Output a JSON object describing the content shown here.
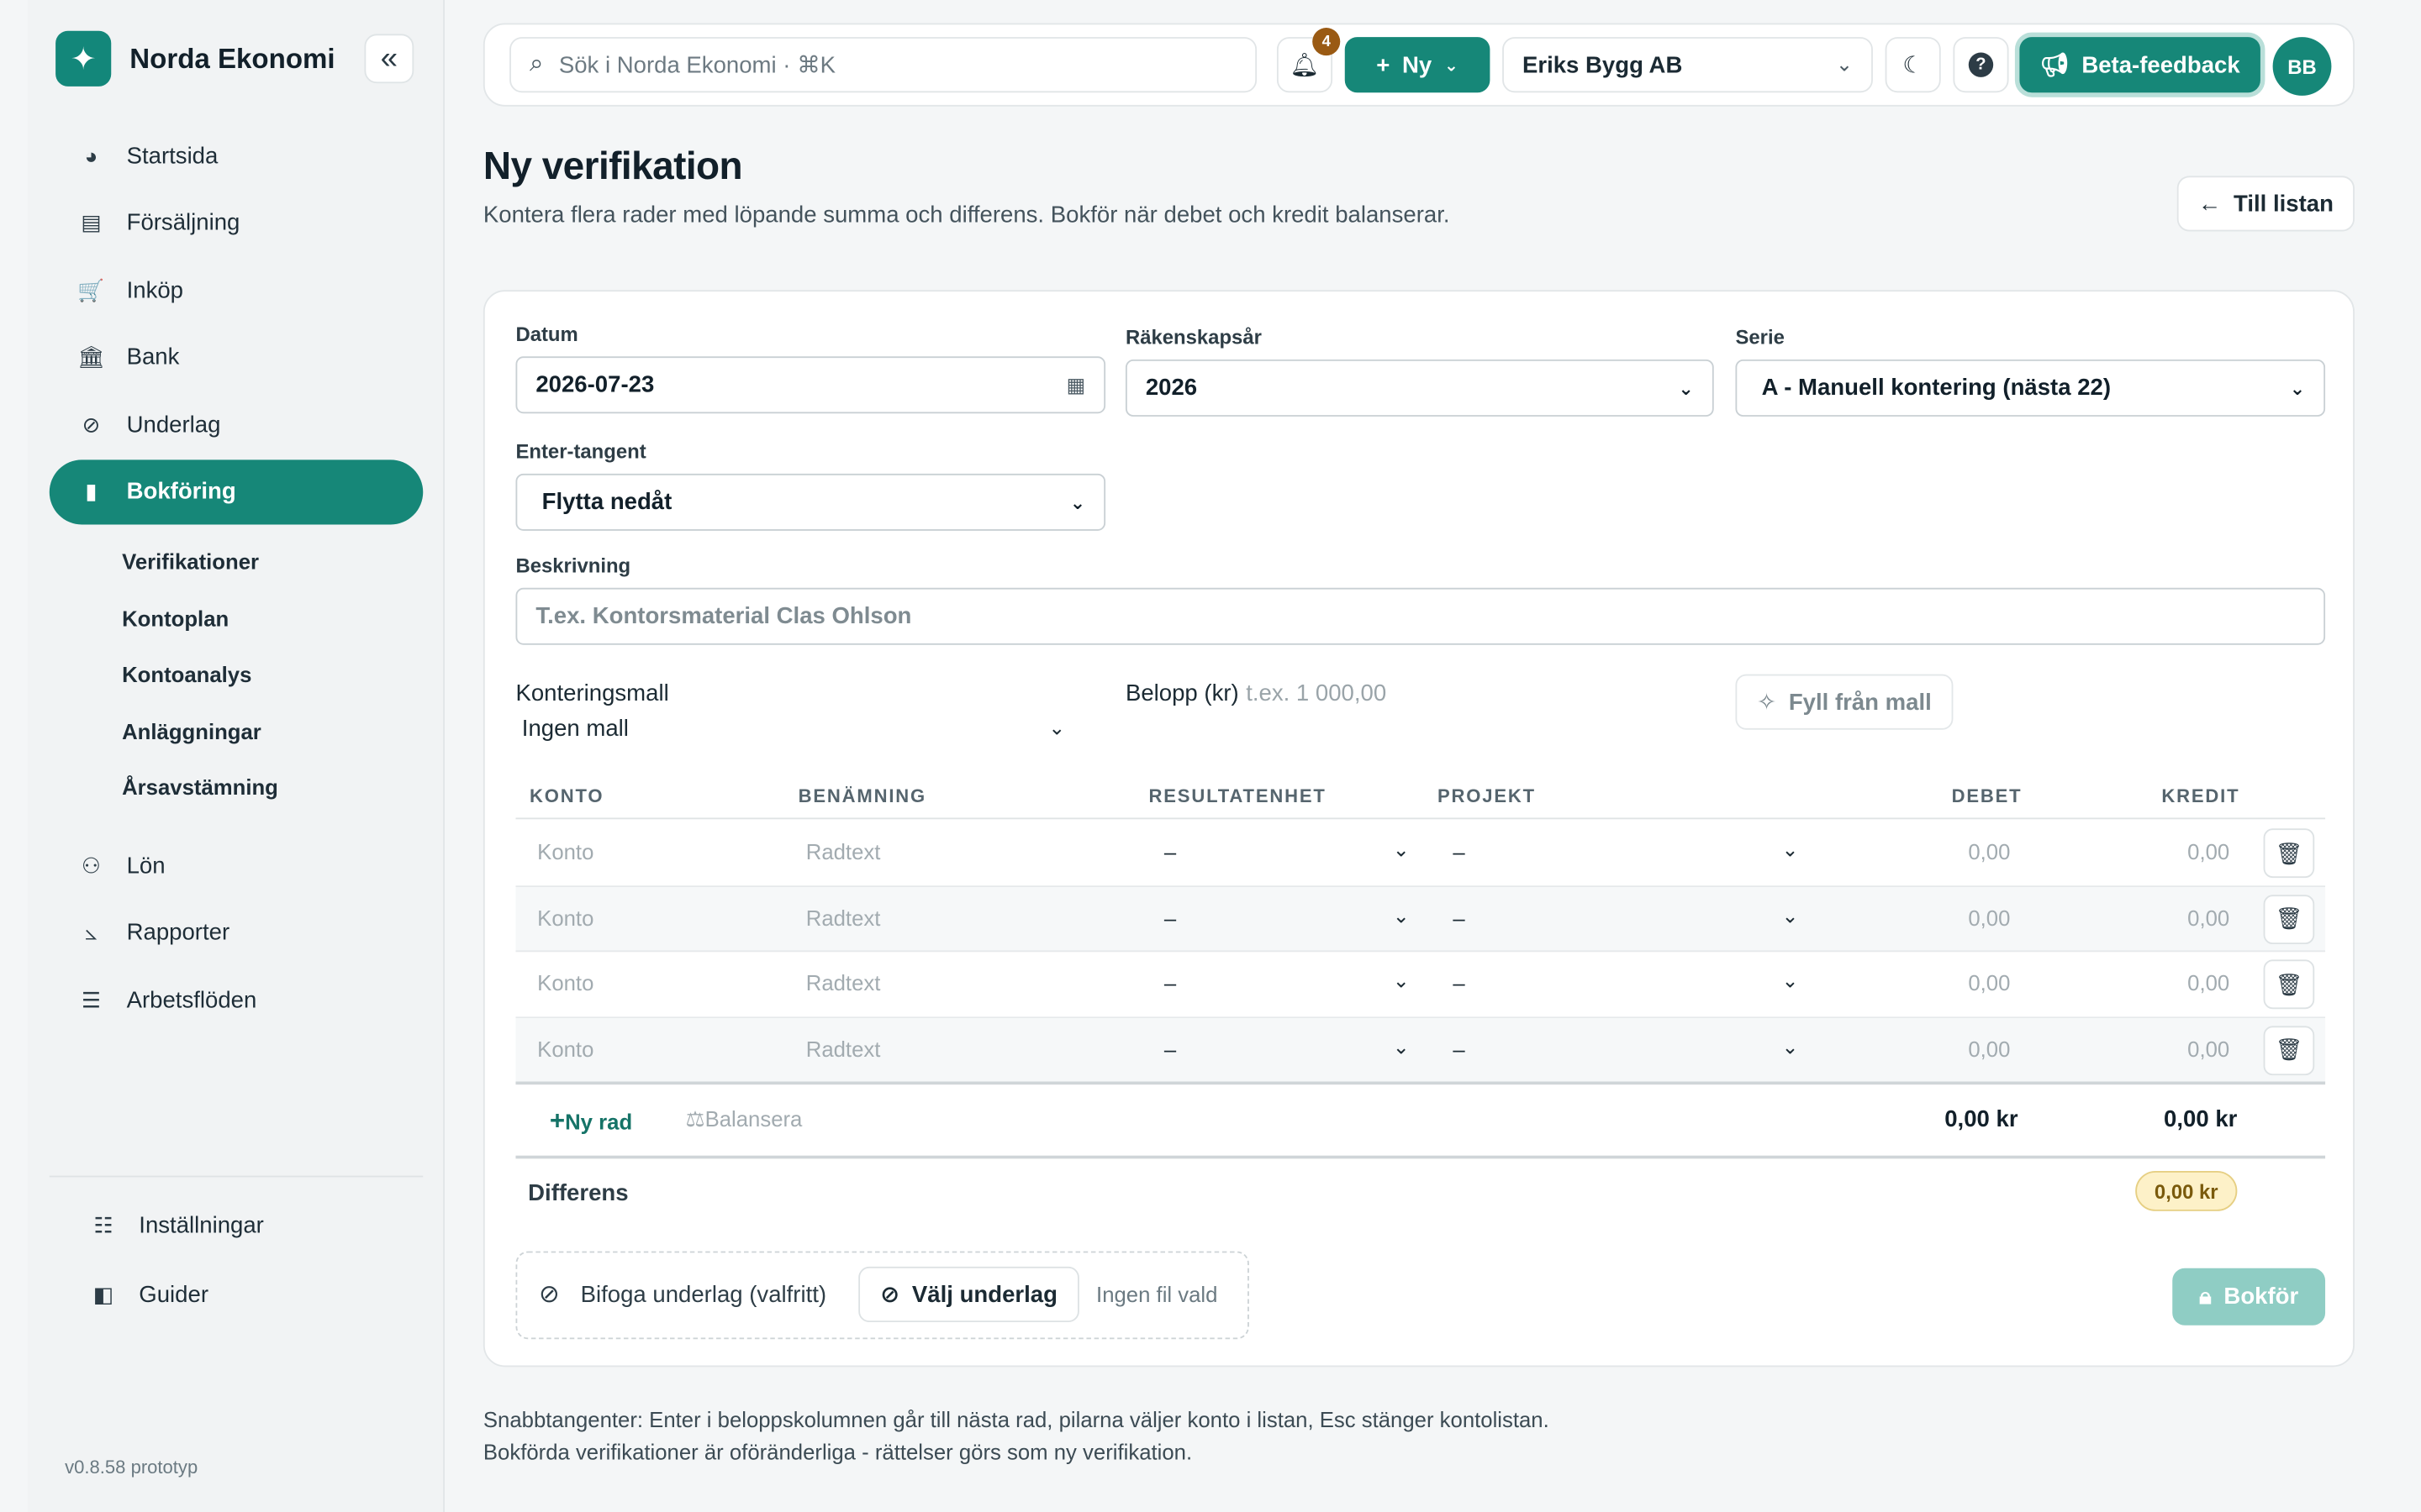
{
  "brand": {
    "name": "Norda Ekonomi",
    "logo_icon": "sparkle-icon",
    "color": "#168778"
  },
  "sidebar": {
    "collapse_label": "«",
    "items": [
      {
        "label": "Startsida",
        "icon": "dashboard-icon",
        "glyph": "◕"
      },
      {
        "label": "Försäljning",
        "icon": "invoice-icon",
        "glyph": "▤"
      },
      {
        "label": "Inköp",
        "icon": "cart-icon",
        "glyph": "🛒"
      },
      {
        "label": "Bank",
        "icon": "bank-icon",
        "glyph": "🏛"
      },
      {
        "label": "Underlag",
        "icon": "paperclip-icon",
        "glyph": "⊘"
      },
      {
        "label": "Bokföring",
        "icon": "book-icon",
        "glyph": "▮",
        "active": true
      }
    ],
    "subitems": [
      "Verifikationer",
      "Kontoplan",
      "Kontoanalys",
      "Anläggningar",
      "Årsavstämning"
    ],
    "items2": [
      {
        "label": "Lön",
        "icon": "people-icon",
        "glyph": "⚇"
      },
      {
        "label": "Rapporter",
        "icon": "chart-icon",
        "glyph": "⦣"
      },
      {
        "label": "Arbetsflöden",
        "icon": "checklist-icon",
        "glyph": "☰"
      }
    ],
    "bottom": [
      {
        "label": "Inställningar",
        "icon": "sliders-icon",
        "glyph": "☷"
      },
      {
        "label": "Guider",
        "icon": "guide-book-icon",
        "glyph": "◧"
      }
    ],
    "version": "v0.8.58 prototyp"
  },
  "topbar": {
    "search_placeholder": "Sök i Norda Ekonomi · ⌘K",
    "notifications_count": "4",
    "new_label": "Ny",
    "company": "Eriks Bygg AB",
    "beta_label": "Beta-feedback",
    "avatar": "BB"
  },
  "header": {
    "title": "Ny verifikation",
    "subtitle": "Kontera flera rader med löpande summa och differens. Bokför när debet och kredit balanserar.",
    "back_label": "Till listan"
  },
  "form": {
    "date_label": "Datum",
    "date_value": "2026-07-23",
    "fiscal_year_label": "Räkenskapsår",
    "fiscal_year_value": "2026",
    "series_label": "Serie",
    "series_value": "A - Manuell kontering (nästa 22)",
    "enter_label": "Enter-tangent",
    "enter_value": "Flytta nedåt",
    "description_label": "Beskrivning",
    "description_placeholder": "T.ex. Kontorsmaterial Clas Ohlson",
    "template_label": "Konteringsmall",
    "template_value": "Ingen mall",
    "amount_label": "Belopp (kr)",
    "amount_placeholder": "t.ex. 1 000,00",
    "fill_button": "Fyll från mall"
  },
  "table": {
    "headers": [
      "KONTO",
      "BENÄMNING",
      "RESULTATENHET",
      "PROJEKT",
      "DEBET",
      "KREDIT"
    ],
    "rows": [
      {
        "konto": "Konto",
        "text": "Radtext",
        "result": "–",
        "project": "–",
        "debet": "0,00",
        "kredit": "0,00"
      },
      {
        "konto": "Konto",
        "text": "Radtext",
        "result": "–",
        "project": "–",
        "debet": "0,00",
        "kredit": "0,00"
      },
      {
        "konto": "Konto",
        "text": "Radtext",
        "result": "–",
        "project": "–",
        "debet": "0,00",
        "kredit": "0,00"
      },
      {
        "konto": "Konto",
        "text": "Radtext",
        "result": "–",
        "project": "–",
        "debet": "0,00",
        "kredit": "0,00"
      }
    ],
    "add_row": "Ny rad",
    "balance": "Balansera",
    "sum_debet": "0,00 kr",
    "sum_kredit": "0,00 kr",
    "diff_label": "Differens",
    "diff_value": "0,00 kr"
  },
  "attachment": {
    "label": "Bifoga underlag (valfritt)",
    "button": "Välj underlag",
    "status": "Ingen fil vald"
  },
  "book_button": "Bokför",
  "footnotes": [
    "Snabbtangenter: Enter i beloppskolumnen går till nästa rad, pilarna väljer konto i listan, Esc stänger kontolistan.",
    "Bokförda verifikationer är oföränderliga - rättelser görs som ny verifikation."
  ]
}
